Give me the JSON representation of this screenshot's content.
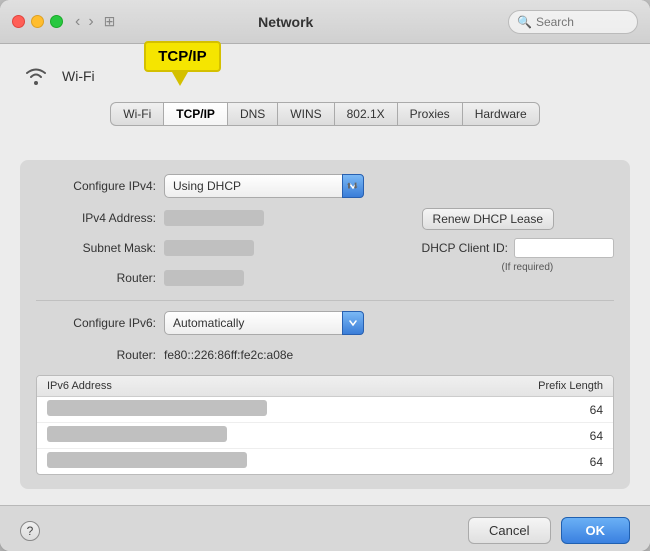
{
  "window": {
    "title": "Network",
    "search_placeholder": "Search"
  },
  "wifi_section": {
    "label": "Wi-Fi"
  },
  "tabs": [
    {
      "id": "wifi",
      "label": "Wi-Fi",
      "active": false
    },
    {
      "id": "tcpip",
      "label": "TCP/IP",
      "active": true
    },
    {
      "id": "dns",
      "label": "DNS",
      "active": false
    },
    {
      "id": "wins",
      "label": "WINS",
      "active": false
    },
    {
      "id": "8021x",
      "label": "802.1X",
      "active": false
    },
    {
      "id": "proxies",
      "label": "Proxies",
      "active": false
    },
    {
      "id": "hardware",
      "label": "Hardware",
      "active": false
    }
  ],
  "annotation": {
    "label": "TCP/IP"
  },
  "tcpip": {
    "configure_ipv4_label": "Configure IPv4:",
    "configure_ipv4_value": "Using DHCP",
    "ipv4_address_label": "IPv4 Address:",
    "subnet_mask_label": "Subnet Mask:",
    "router_label": "Router:",
    "configure_ipv6_label": "Configure IPv6:",
    "configure_ipv6_value": "Automatically",
    "ipv6_router_label": "Router:",
    "ipv6_router_value": "fe80::226:86ff:fe2c:a08e",
    "dhcp_client_id_label": "DHCP Client ID:",
    "if_required": "(If required)",
    "renew_dhcp_label": "Renew DHCP Lease"
  },
  "ipv6_table": {
    "col_address": "IPv6 Address",
    "col_prefix": "Prefix Length",
    "rows": [
      {
        "address_blurred": true,
        "prefix": "64"
      },
      {
        "address_blurred": true,
        "prefix": "64"
      },
      {
        "address_blurred": true,
        "prefix": "64"
      }
    ]
  },
  "bottom": {
    "help_label": "?",
    "cancel_label": "Cancel",
    "ok_label": "OK"
  }
}
